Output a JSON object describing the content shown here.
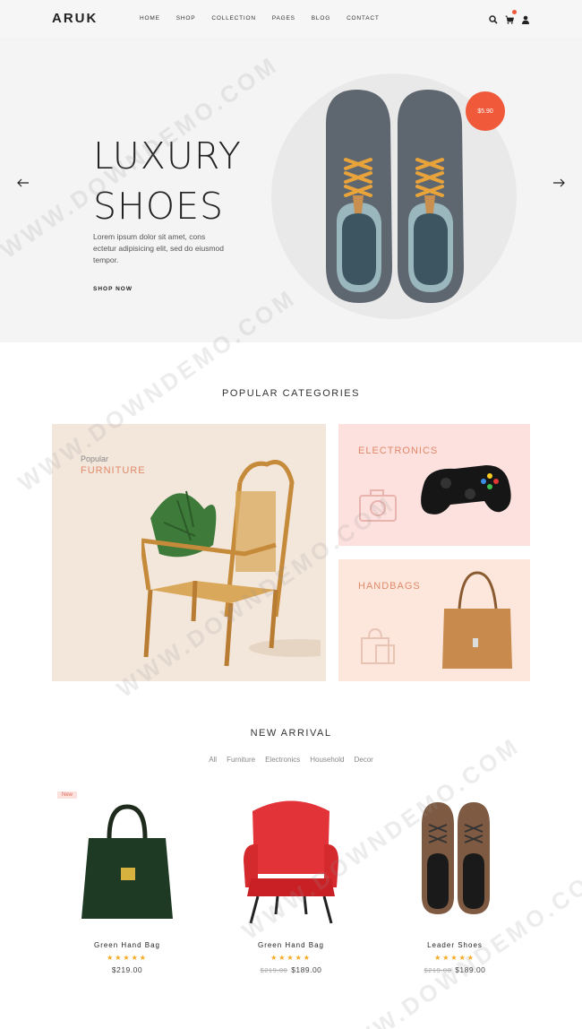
{
  "brand": {
    "logo": "ARUK"
  },
  "nav": {
    "items": [
      "HOME",
      "SHOP",
      "COLLECTION",
      "PAGES",
      "BLOG",
      "CONTACT"
    ]
  },
  "hero": {
    "title_line1": "LUXURY",
    "title_line2": "SHOES",
    "text": "Lorem ipsum dolor sit amet, cons ectetur adipisicing elit, sed do eiusmod tempor.",
    "button": "SHOP NOW",
    "price": "$5.90"
  },
  "categories": {
    "title": "POPULAR CATEGORIES",
    "furniture": {
      "small": "Popular",
      "label": "FURNITURE"
    },
    "electronics": {
      "label": "ELECTRONICS"
    },
    "handbags": {
      "label": "HANDBAGS"
    }
  },
  "new_arrival": {
    "title": "NEW ARRIVAL",
    "tabs": [
      "All",
      "Furniture",
      "Electronics",
      "Household",
      "Decor"
    ],
    "products": [
      {
        "badge": "New",
        "name": "Green Hand Bag",
        "stars": "★★★★★",
        "old_price": "",
        "price": "$219.00"
      },
      {
        "badge": "",
        "name": "Green Hand Bag",
        "stars": "★★★★★",
        "old_price": "$219.00",
        "price": "$189.00"
      },
      {
        "badge": "",
        "name": "Leader Shoes",
        "stars": "★★★★★",
        "old_price": "$219.00",
        "price": "$189.00"
      }
    ]
  },
  "watermark": "WWW.DOWNDEMO.COM",
  "colors": {
    "accent": "#f05a3a",
    "category_text": "#e0896a",
    "star": "#f4a81e"
  },
  "icons": [
    "search-icon",
    "cart-icon",
    "user-icon",
    "arrow-left-icon",
    "arrow-right-icon",
    "camera-icon",
    "shopping-bag-icon"
  ]
}
